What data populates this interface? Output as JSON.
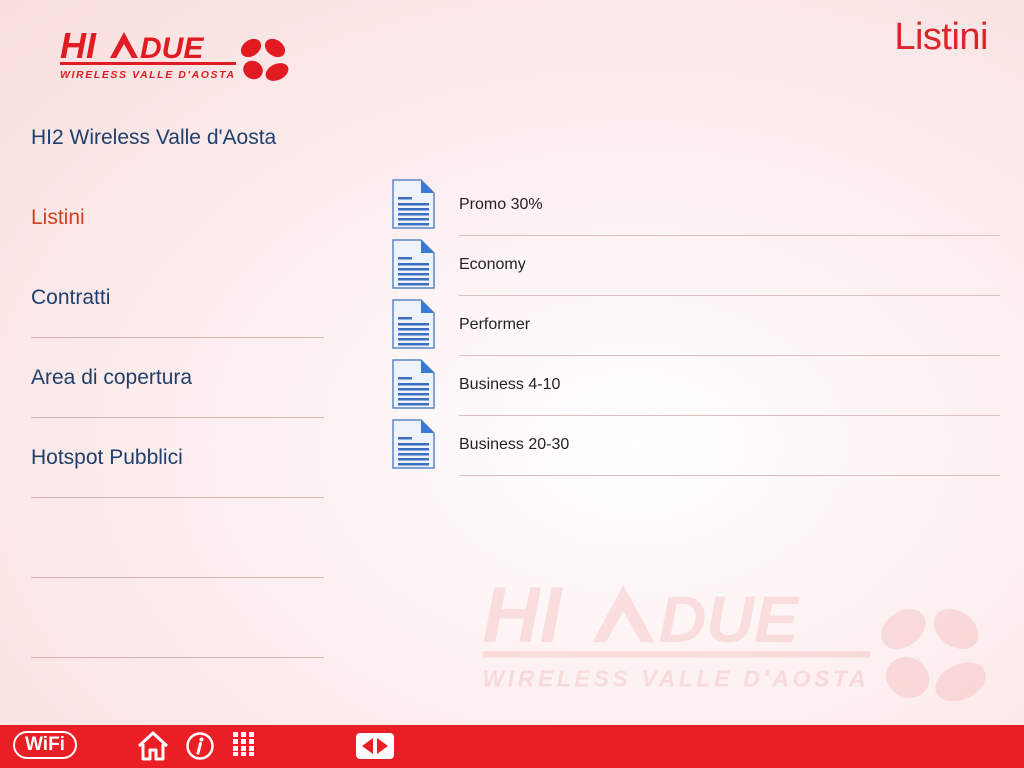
{
  "header": {
    "title": "Listini",
    "logo_text": "HI2DUE",
    "logo_tagline": "WIRELESS VALLE D'AOSTA"
  },
  "sidebar": {
    "items": [
      {
        "label": "HI2 Wireless Valle d'Aosta",
        "active": false
      },
      {
        "label": "Listini",
        "active": true
      },
      {
        "label": "Contratti",
        "active": false
      },
      {
        "label": "Area di copertura",
        "active": false
      },
      {
        "label": "Hotspot Pubblici",
        "active": false
      }
    ]
  },
  "documents": [
    {
      "label": "Promo 30%",
      "icon": "document-icon"
    },
    {
      "label": "Economy",
      "icon": "document-icon"
    },
    {
      "label": "Performer",
      "icon": "document-icon"
    },
    {
      "label": "Business 4-10",
      "icon": "document-icon"
    },
    {
      "label": "Business 20-30",
      "icon": "document-icon"
    }
  ],
  "toolbar": {
    "wifi_label": "WiFi",
    "icons": [
      "wifi-icon",
      "home-icon",
      "info-icon",
      "grid-icon",
      "arrows-icon"
    ]
  },
  "colors": {
    "accent": "#ea1f26",
    "title": "#d8262a",
    "active_item": "#d2401c",
    "nav_text": "#1f3f6c"
  }
}
